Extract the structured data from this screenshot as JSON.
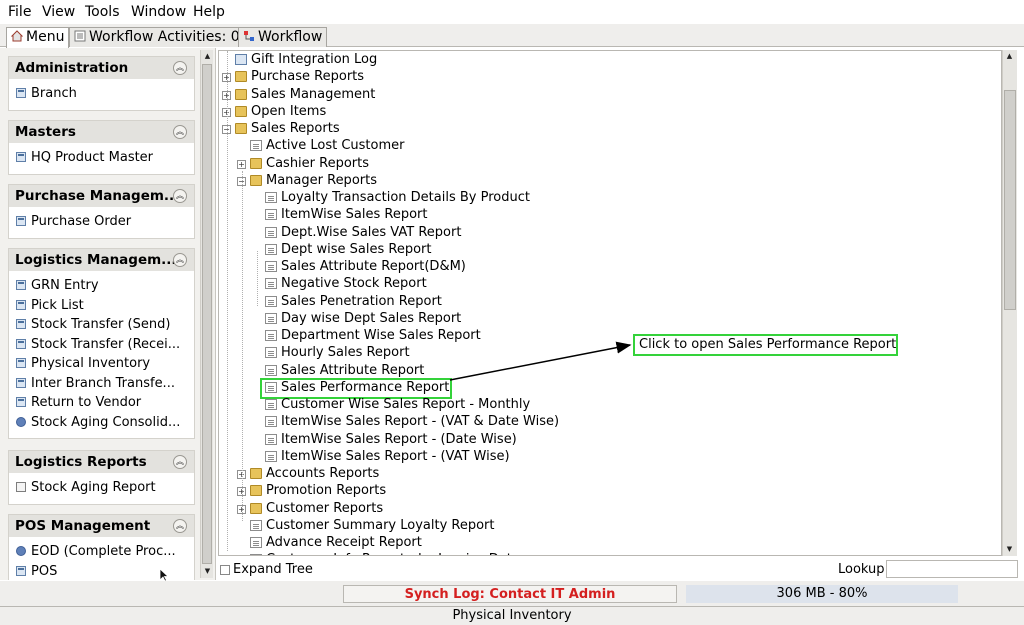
{
  "menubar": {
    "file": "File",
    "view": "View",
    "tools": "Tools",
    "window": "Window",
    "help": "Help"
  },
  "tabs": [
    {
      "label": "Menu",
      "icon": "home-icon"
    },
    {
      "label": "Workflow Activities: 0",
      "icon": "workflow-activities-icon"
    },
    {
      "label": "Workflow",
      "icon": "workflow-icon"
    }
  ],
  "sidebar": [
    {
      "title": "Administration",
      "items": [
        {
          "label": "Branch",
          "icon": "form-icon"
        }
      ]
    },
    {
      "title": "Masters",
      "items": [
        {
          "label": "HQ Product Master",
          "icon": "form-icon"
        }
      ]
    },
    {
      "title": "Purchase Managem...",
      "items": [
        {
          "label": "Purchase Order",
          "icon": "form-icon"
        }
      ]
    },
    {
      "title": "Logistics Managem...",
      "items": [
        {
          "label": "GRN Entry",
          "icon": "form-icon"
        },
        {
          "label": "Pick List",
          "icon": "form-icon"
        },
        {
          "label": "Stock Transfer (Send)",
          "icon": "form-icon"
        },
        {
          "label": "Stock Transfer (Recei...",
          "icon": "form-icon"
        },
        {
          "label": "Physical Inventory",
          "icon": "form-icon"
        },
        {
          "label": "Inter Branch Transfe...",
          "icon": "form-icon"
        },
        {
          "label": "Return to Vendor",
          "icon": "form-icon"
        },
        {
          "label": "Stock Aging Consolid...",
          "icon": "process-icon"
        }
      ]
    },
    {
      "title": "Logistics Reports",
      "items": [
        {
          "label": "Stock Aging Report",
          "icon": "report-icon"
        }
      ]
    },
    {
      "title": "POS Management",
      "items": [
        {
          "label": "EOD (Complete Proc...",
          "icon": "process-icon"
        },
        {
          "label": "POS",
          "icon": "form-icon"
        }
      ]
    }
  ],
  "tree": {
    "nodes": [
      {
        "label": "Gift Integration Log",
        "type": "form"
      },
      {
        "label": "Purchase Reports",
        "type": "folder"
      },
      {
        "label": "Sales Management",
        "type": "folder"
      },
      {
        "label": "Open Items",
        "type": "folder"
      },
      {
        "label": "Sales Reports",
        "type": "folder-open"
      },
      {
        "label": "Active Lost Customer",
        "type": "report"
      },
      {
        "label": "Cashier Reports",
        "type": "folder"
      },
      {
        "label": "Manager Reports",
        "type": "folder-open"
      },
      {
        "label": "Loyalty Transaction Details By Product",
        "type": "report"
      },
      {
        "label": "ItemWise Sales Report",
        "type": "report"
      },
      {
        "label": "Dept.Wise Sales VAT Report",
        "type": "report"
      },
      {
        "label": "Dept wise Sales Report",
        "type": "report"
      },
      {
        "label": "Sales Attribute Report(D&M)",
        "type": "report"
      },
      {
        "label": "Negative Stock Report",
        "type": "report"
      },
      {
        "label": "Sales Penetration Report",
        "type": "report"
      },
      {
        "label": "Day wise Dept Sales Report",
        "type": "report"
      },
      {
        "label": "Department Wise Sales Report",
        "type": "report"
      },
      {
        "label": "Hourly Sales Report",
        "type": "report"
      },
      {
        "label": "Sales Attribute Report",
        "type": "report"
      },
      {
        "label": "Sales Performance Report",
        "type": "report"
      },
      {
        "label": "Customer Wise Sales Report - Monthly",
        "type": "report"
      },
      {
        "label": "ItemWise Sales Report - (VAT & Date Wise)",
        "type": "report"
      },
      {
        "label": "ItemWise Sales Report - (Date Wise)",
        "type": "report"
      },
      {
        "label": "ItemWise Sales Report - (VAT Wise)",
        "type": "report"
      },
      {
        "label": "Accounts Reports",
        "type": "folder"
      },
      {
        "label": "Promotion Reports",
        "type": "folder"
      },
      {
        "label": "Customer Reports",
        "type": "folder"
      },
      {
        "label": "Customer Summary Loyalty Report",
        "type": "report"
      },
      {
        "label": "Advance Receipt Report",
        "type": "report"
      },
      {
        "label": "Customer Info Report - by Invoice Date",
        "type": "report"
      }
    ],
    "expand_tree_label": "Expand Tree",
    "lookup_label": "Lookup",
    "lookup_value": ""
  },
  "callout": "Click to open Sales Performance Report",
  "status": {
    "sync_log": "Synch Log: Contact IT Admin",
    "memory": "306 MB - 80%",
    "bottom": "Physical Inventory"
  },
  "colors": {
    "highlight": "#34d23a",
    "sync_text": "#d41f1f"
  }
}
